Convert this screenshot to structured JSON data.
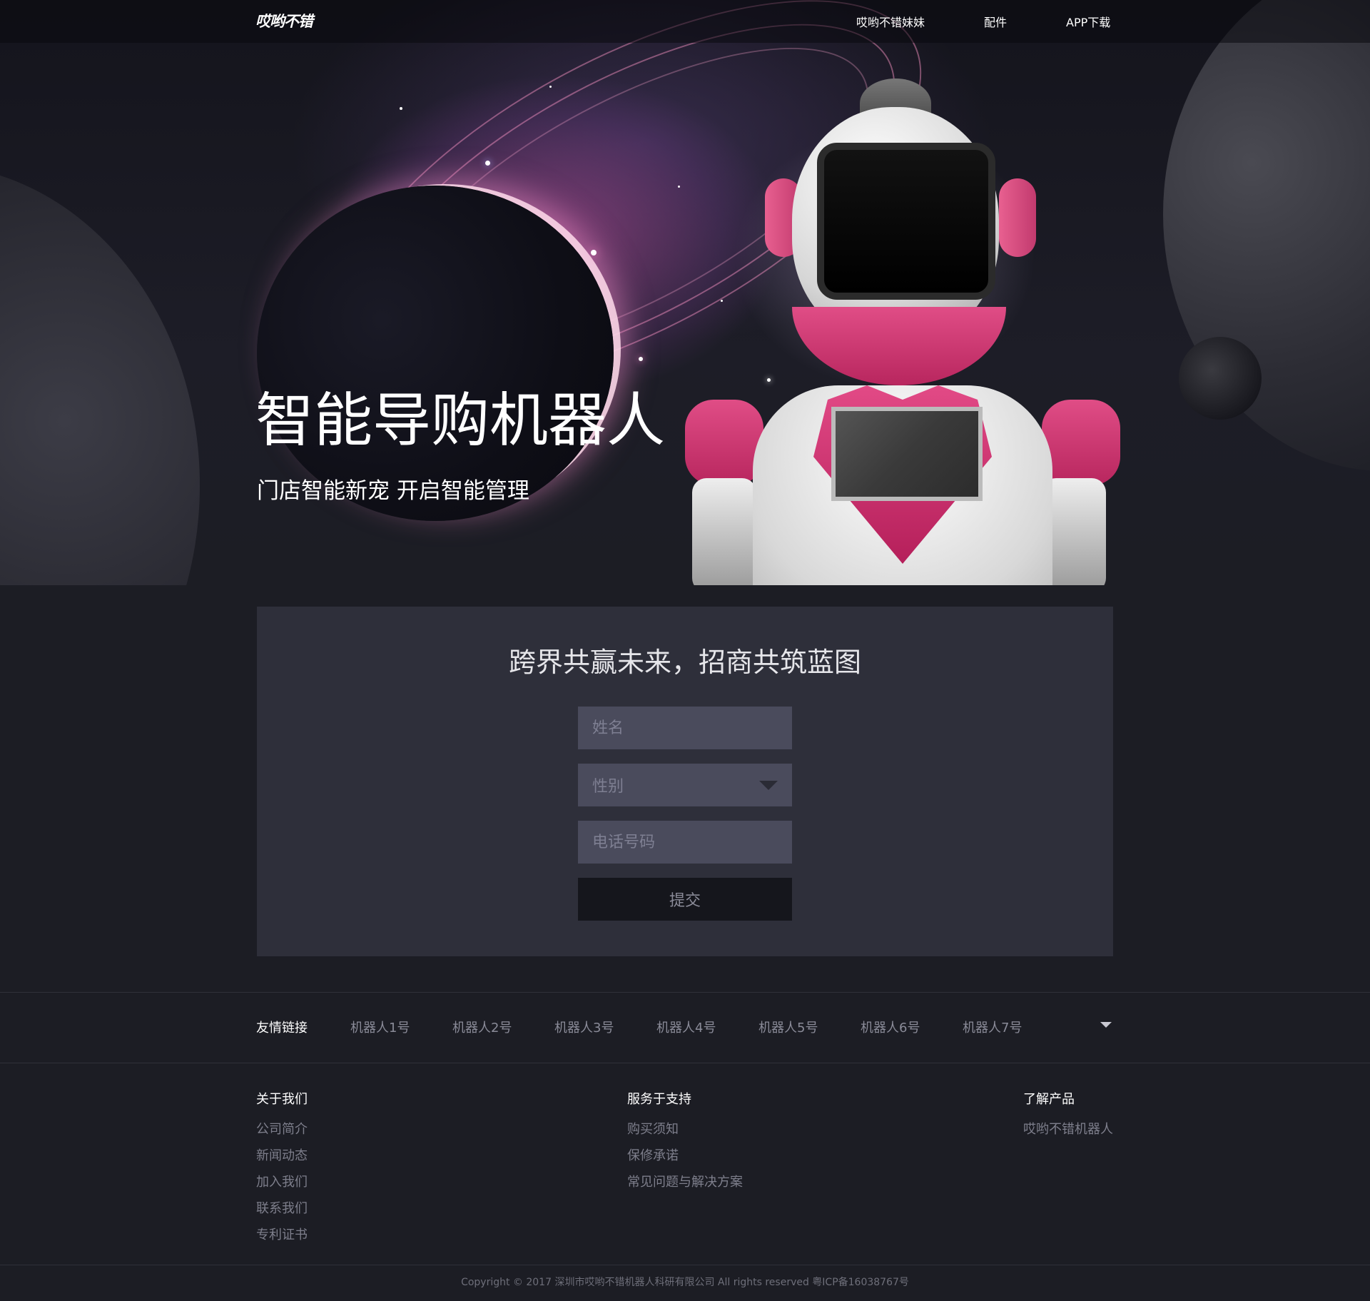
{
  "header": {
    "logo": "哎哟不错",
    "nav": [
      "哎哟不错妹妹",
      "配件",
      "APP下载"
    ]
  },
  "hero": {
    "title": "智能导购机器人",
    "subtitle": "门店智能新宠 开启智能管理"
  },
  "form": {
    "title": "跨界共赢未来，招商共筑蓝图",
    "name_placeholder": "姓名",
    "gender_placeholder": "性别",
    "phone_placeholder": "电话号码",
    "submit_label": "提交"
  },
  "links": {
    "title": "友情链接",
    "items": [
      "机器人1号",
      "机器人2号",
      "机器人3号",
      "机器人4号",
      "机器人5号",
      "机器人6号",
      "机器人7号"
    ]
  },
  "footer": {
    "columns": [
      {
        "title": "关于我们",
        "items": [
          "公司简介",
          "新闻动态",
          "加入我们",
          "联系我们",
          "专利证书"
        ]
      },
      {
        "title": "服务于支持",
        "items": [
          "购买须知",
          "保修承诺",
          "常见问题与解决方案"
        ]
      },
      {
        "title": "了解产品",
        "items": [
          "哎哟不错机器人"
        ]
      }
    ],
    "copyright": "Copyright © 2017 深圳市哎哟不错机器人科研有限公司 All rights reserved 粤ICP备16038767号"
  },
  "colors": {
    "page_bg": "#1c1d24",
    "panel_bg": "#2e2f3a",
    "input_bg": "#4a4b5c",
    "button_bg": "#15161c",
    "accent_pink": "#e04d86"
  }
}
